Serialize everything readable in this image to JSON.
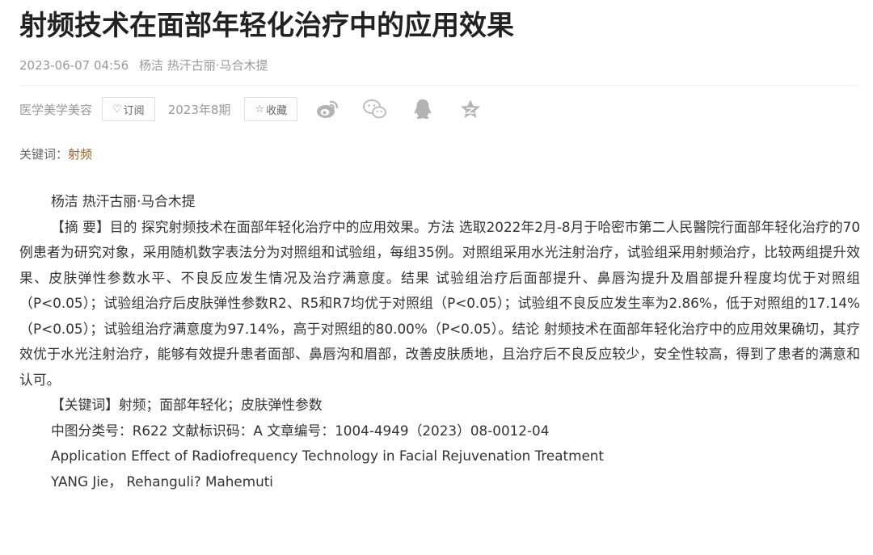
{
  "article": {
    "title": "射频技术在面部年轻化治疗中的应用效果",
    "date": "2023-06-07 04:56",
    "authors": "杨洁  热汗古丽·马合木提"
  },
  "toolbar": {
    "category": "医学美学美容",
    "subscribe_label": "订阅",
    "issue": "2023年8期",
    "favorite_label": "收藏"
  },
  "icons": {
    "subscribe": "heart-outline-icon",
    "favorite": "star-outline-icon",
    "share": [
      "weibo-icon",
      "wechat-icon",
      "qq-icon",
      "qzone-icon"
    ]
  },
  "colors": {
    "keyword_link": "#a0622d",
    "muted_text": "#999999",
    "share_icons": "#b0b0b0"
  },
  "keywords_line": {
    "label": "关键词：",
    "keyword": "射频"
  },
  "body": {
    "authors": "杨洁 热汗古丽·马合木提",
    "abstract": "【摘 要】目的 探究射频技术在面部年轻化治疗中的应用效果。方法 选取2022年2月-8月于哈密市第二人民醫院行面部年轻化治疗的70例患者为研究对象，采用随机数字表法分为对照组和试验组，每组35例。对照组采用水光注射治疗，试验组采用射频治疗，比较两组提升效果、皮肤弹性参数水平、不良反应发生情况及治疗满意度。结果 试验组治疗后面部提升、鼻唇沟提升及眉部提升程度均优于对照组（P<0.05）；试验组治疗后皮肤弹性参数R2、R5和R7均优于对照组（P<0.05）；试验组不良反应发生率为2.86%，低于对照组的17.14%（P<0.05）；试验组治疗满意度为97.14%，高于对照组的80.00%（P<0.05）。结论 射频技术在面部年轻化治疗中的应用效果确切，其疗效优于水光注射治疗，能够有效提升患者面部、鼻唇沟和眉部，改善皮肤质地，且治疗后不良反应较少，安全性较高，得到了患者的满意和认可。",
    "keywords": "【关键词】射频；面部年轻化；皮肤弹性参数",
    "classification": "中图分类号：R622 文献标识码：A 文章编号：1004-4949（2023）08-0012-04",
    "english_title": "Application Effect of Radiofrequency Technology in Facial Rejuvenation Treatment",
    "english_authors": "YANG Jie，  Rehanguli?  Mahemuti"
  }
}
